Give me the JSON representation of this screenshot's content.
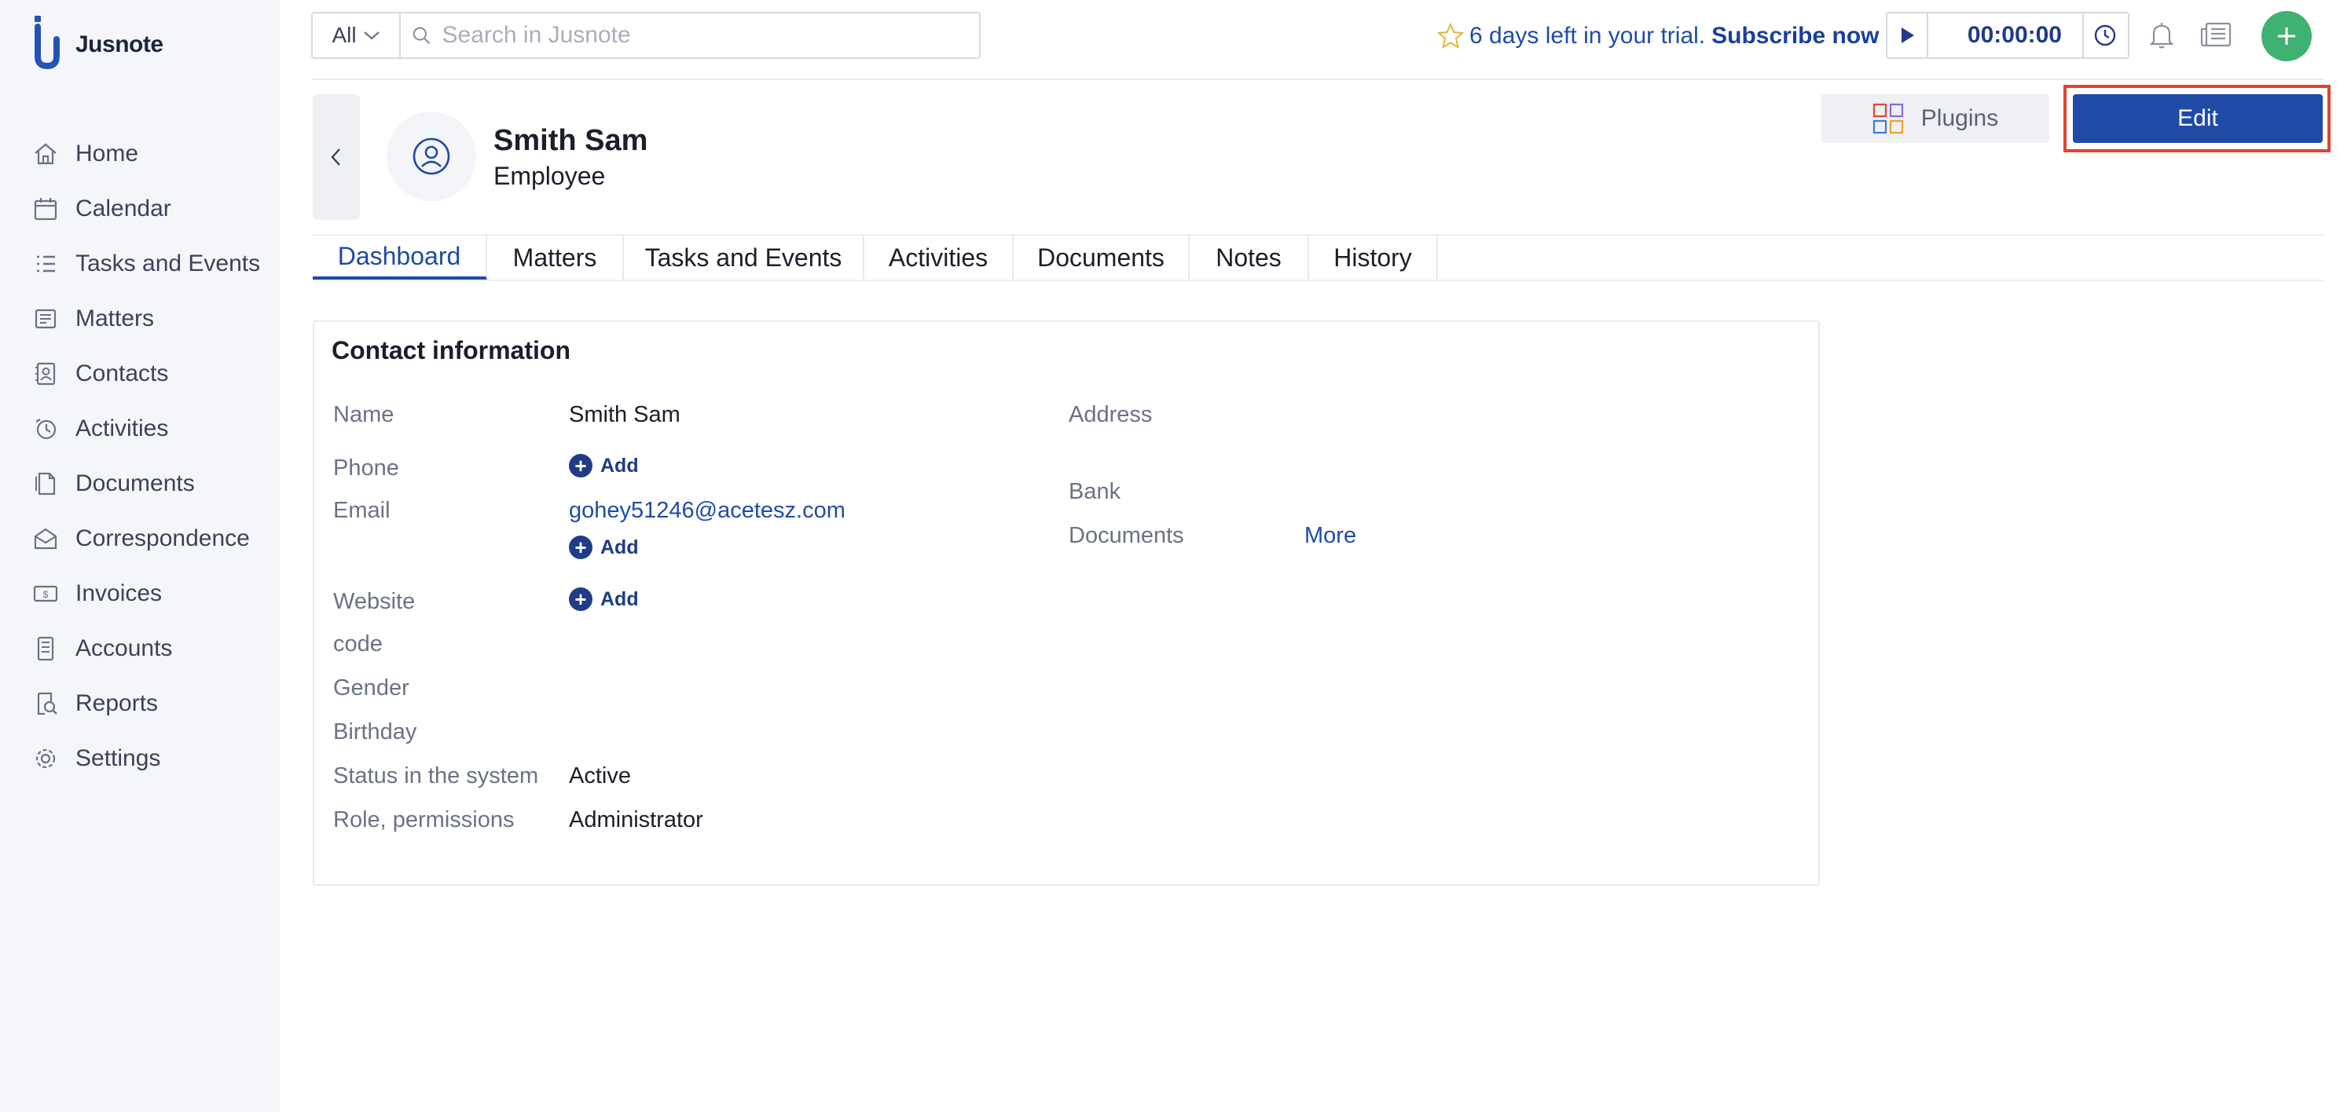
{
  "app": {
    "name": "Jusnote"
  },
  "sidebar": {
    "items": [
      {
        "label": "Home",
        "icon": "home-icon"
      },
      {
        "label": "Calendar",
        "icon": "calendar-icon"
      },
      {
        "label": "Tasks and Events",
        "icon": "tasks-icon"
      },
      {
        "label": "Matters",
        "icon": "matters-icon"
      },
      {
        "label": "Contacts",
        "icon": "contacts-icon"
      },
      {
        "label": "Activities",
        "icon": "activities-icon"
      },
      {
        "label": "Documents",
        "icon": "documents-icon"
      },
      {
        "label": "Correspondence",
        "icon": "correspondence-icon"
      },
      {
        "label": "Invoices",
        "icon": "invoices-icon"
      },
      {
        "label": "Accounts",
        "icon": "accounts-icon"
      },
      {
        "label": "Reports",
        "icon": "reports-icon"
      },
      {
        "label": "Settings",
        "icon": "settings-icon"
      }
    ]
  },
  "topbar": {
    "scope_value": "All",
    "search_placeholder": "Search in Jusnote",
    "trial_text": "6 days left in your trial.",
    "subscribe_label": "Subscribe now",
    "timer_value": "00:00:00"
  },
  "header": {
    "name": "Smith Sam",
    "role": "Employee",
    "plugins_label": "Plugins",
    "edit_label": "Edit"
  },
  "tabs": [
    {
      "label": "Dashboard",
      "active": true
    },
    {
      "label": "Matters"
    },
    {
      "label": "Tasks and Events"
    },
    {
      "label": "Activities"
    },
    {
      "label": "Documents"
    },
    {
      "label": "Notes"
    },
    {
      "label": "History"
    }
  ],
  "contact": {
    "title": "Contact information",
    "name_label": "Name",
    "name_value": "Smith Sam",
    "phone_label": "Phone",
    "add_label": "Add",
    "email_label": "Email",
    "email_value": "gohey51246@acetesz.com",
    "website_label": "Website",
    "code_label": "code",
    "gender_label": "Gender",
    "birthday_label": "Birthday",
    "status_label": "Status in the system",
    "status_value": "Active",
    "role_label": "Role, permissions",
    "role_value": "Administrator",
    "address_label": "Address",
    "bank_label": "Bank",
    "documents_label": "Documents",
    "more_label": "More"
  },
  "colors": {
    "accent": "#1f4aa6",
    "add_button": "#3fb271",
    "highlight": "#e0432f",
    "sidebar_bg": "#f4f6f9"
  }
}
